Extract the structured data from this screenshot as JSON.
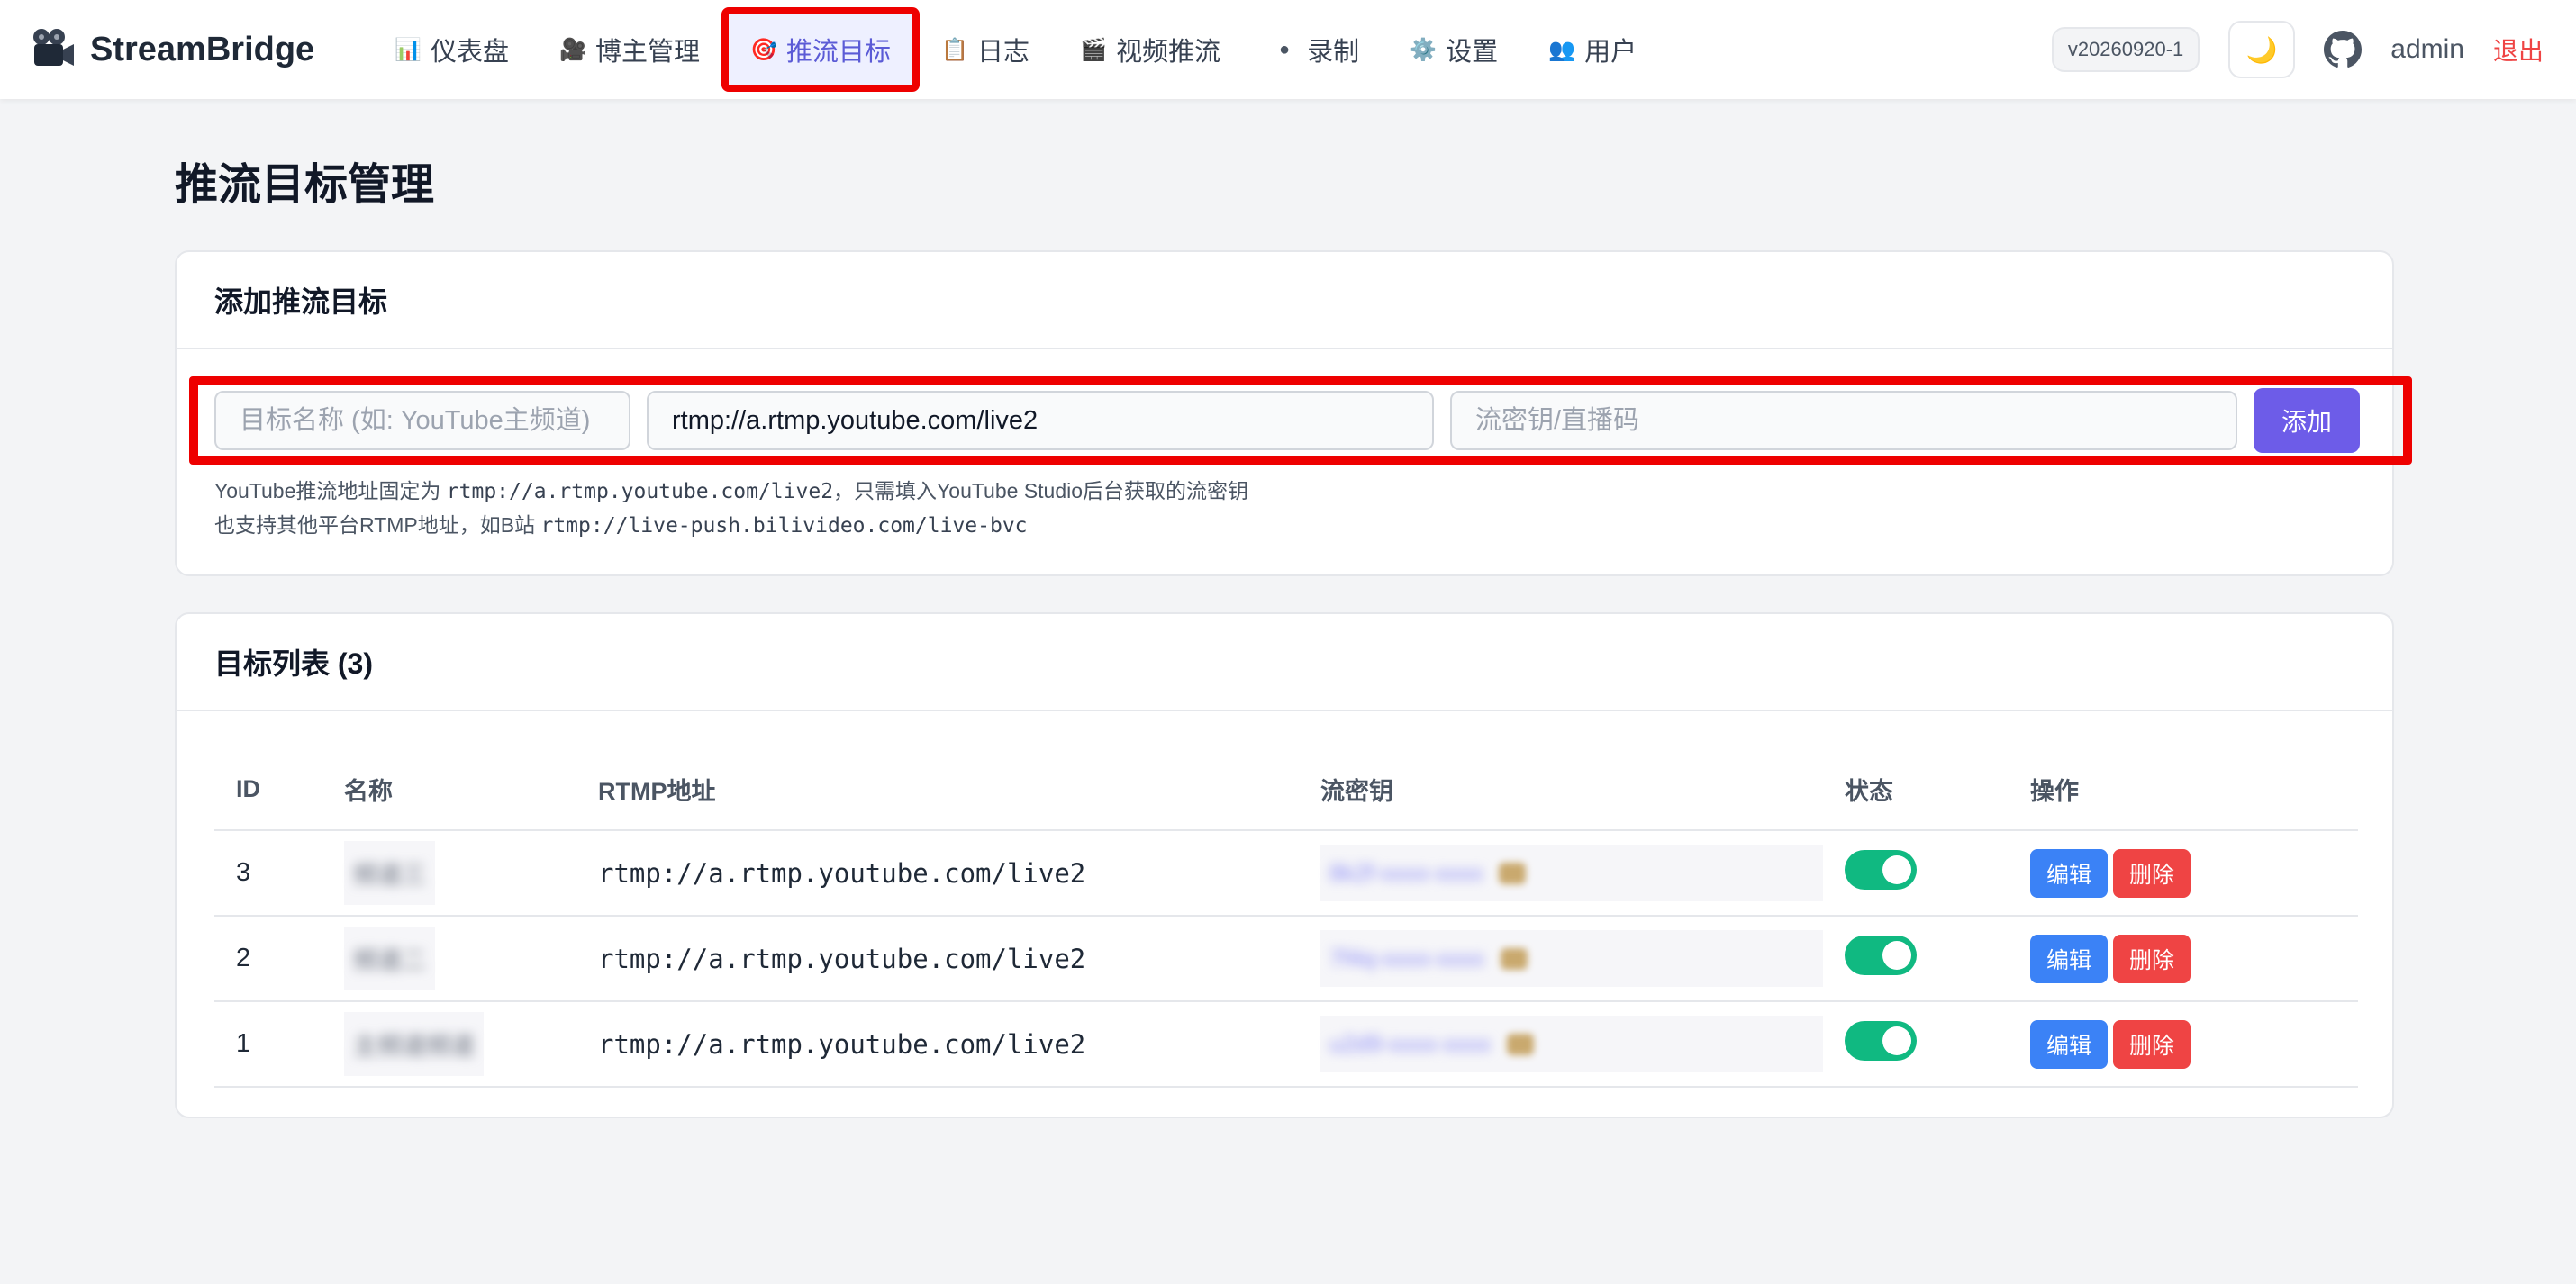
{
  "brand": {
    "name": "StreamBridge",
    "icon": "camera-icon"
  },
  "nav": {
    "items": [
      {
        "label": "仪表盘",
        "icon": "📊",
        "icon_name": "bar-chart-icon",
        "active": false
      },
      {
        "label": "博主管理",
        "icon": "🎥",
        "icon_name": "movie-camera-icon",
        "active": false
      },
      {
        "label": "推流目标",
        "icon": "🎯",
        "icon_name": "target-icon",
        "active": true
      },
      {
        "label": "日志",
        "icon": "📋",
        "icon_name": "clipboard-icon",
        "active": false
      },
      {
        "label": "视频推流",
        "icon": "🎬",
        "icon_name": "clapper-icon",
        "active": false
      },
      {
        "label": "录制",
        "icon": "●",
        "icon_name": "record-dot-icon",
        "active": false
      },
      {
        "label": "设置",
        "icon": "⚙️",
        "icon_name": "gear-icon",
        "active": false
      },
      {
        "label": "用户",
        "icon": "👥",
        "icon_name": "users-icon",
        "active": false
      }
    ],
    "version": "v20260920-1",
    "theme_icon": "🌙",
    "username": "admin",
    "logout": "退出"
  },
  "page": {
    "title": "推流目标管理"
  },
  "add_card": {
    "title": "添加推流目标",
    "name_placeholder": "目标名称 (如: YouTube主频道)",
    "url_value": "rtmp://a.rtmp.youtube.com/live2",
    "key_placeholder": "流密钥/直播码",
    "add_label": "添加",
    "hint1_prefix": "YouTube推流地址固定为 ",
    "hint1_code": "rtmp://a.rtmp.youtube.com/live2",
    "hint1_suffix": "，只需填入YouTube Studio后台获取的流密钥",
    "hint2_prefix": "也支持其他平台RTMP地址，如B站 ",
    "hint2_code": "rtmp://live-push.bilivideo.com/live-bvc"
  },
  "list_card": {
    "title": "目标列表 (3)",
    "columns": {
      "id": "ID",
      "name": "名称",
      "url": "RTMP地址",
      "key": "流密钥",
      "status": "状态",
      "actions": "操作"
    },
    "rows": [
      {
        "id": "3",
        "name": "频道三",
        "url": "rtmp://a.rtmp.youtube.com/live2",
        "key": "8k2f-xxxx-xxxx",
        "enabled": true,
        "edit": "编辑",
        "delete": "删除"
      },
      {
        "id": "2",
        "name": "频道二",
        "url": "rtmp://a.rtmp.youtube.com/live2",
        "key": "7f4q-xxxx-xxxx",
        "enabled": true,
        "edit": "编辑",
        "delete": "删除"
      },
      {
        "id": "1",
        "name": "主频道频道",
        "url": "rtmp://a.rtmp.youtube.com/live2",
        "key": "u2d9-xxxx-xxxx",
        "enabled": true,
        "edit": "编辑",
        "delete": "删除"
      }
    ]
  },
  "colors": {
    "accent": "#6d5ce8",
    "active_nav": "#5b5bd6",
    "highlight": "#ee0000",
    "toggle_on": "#10b981",
    "edit": "#3b82f6",
    "delete": "#ef4444"
  }
}
